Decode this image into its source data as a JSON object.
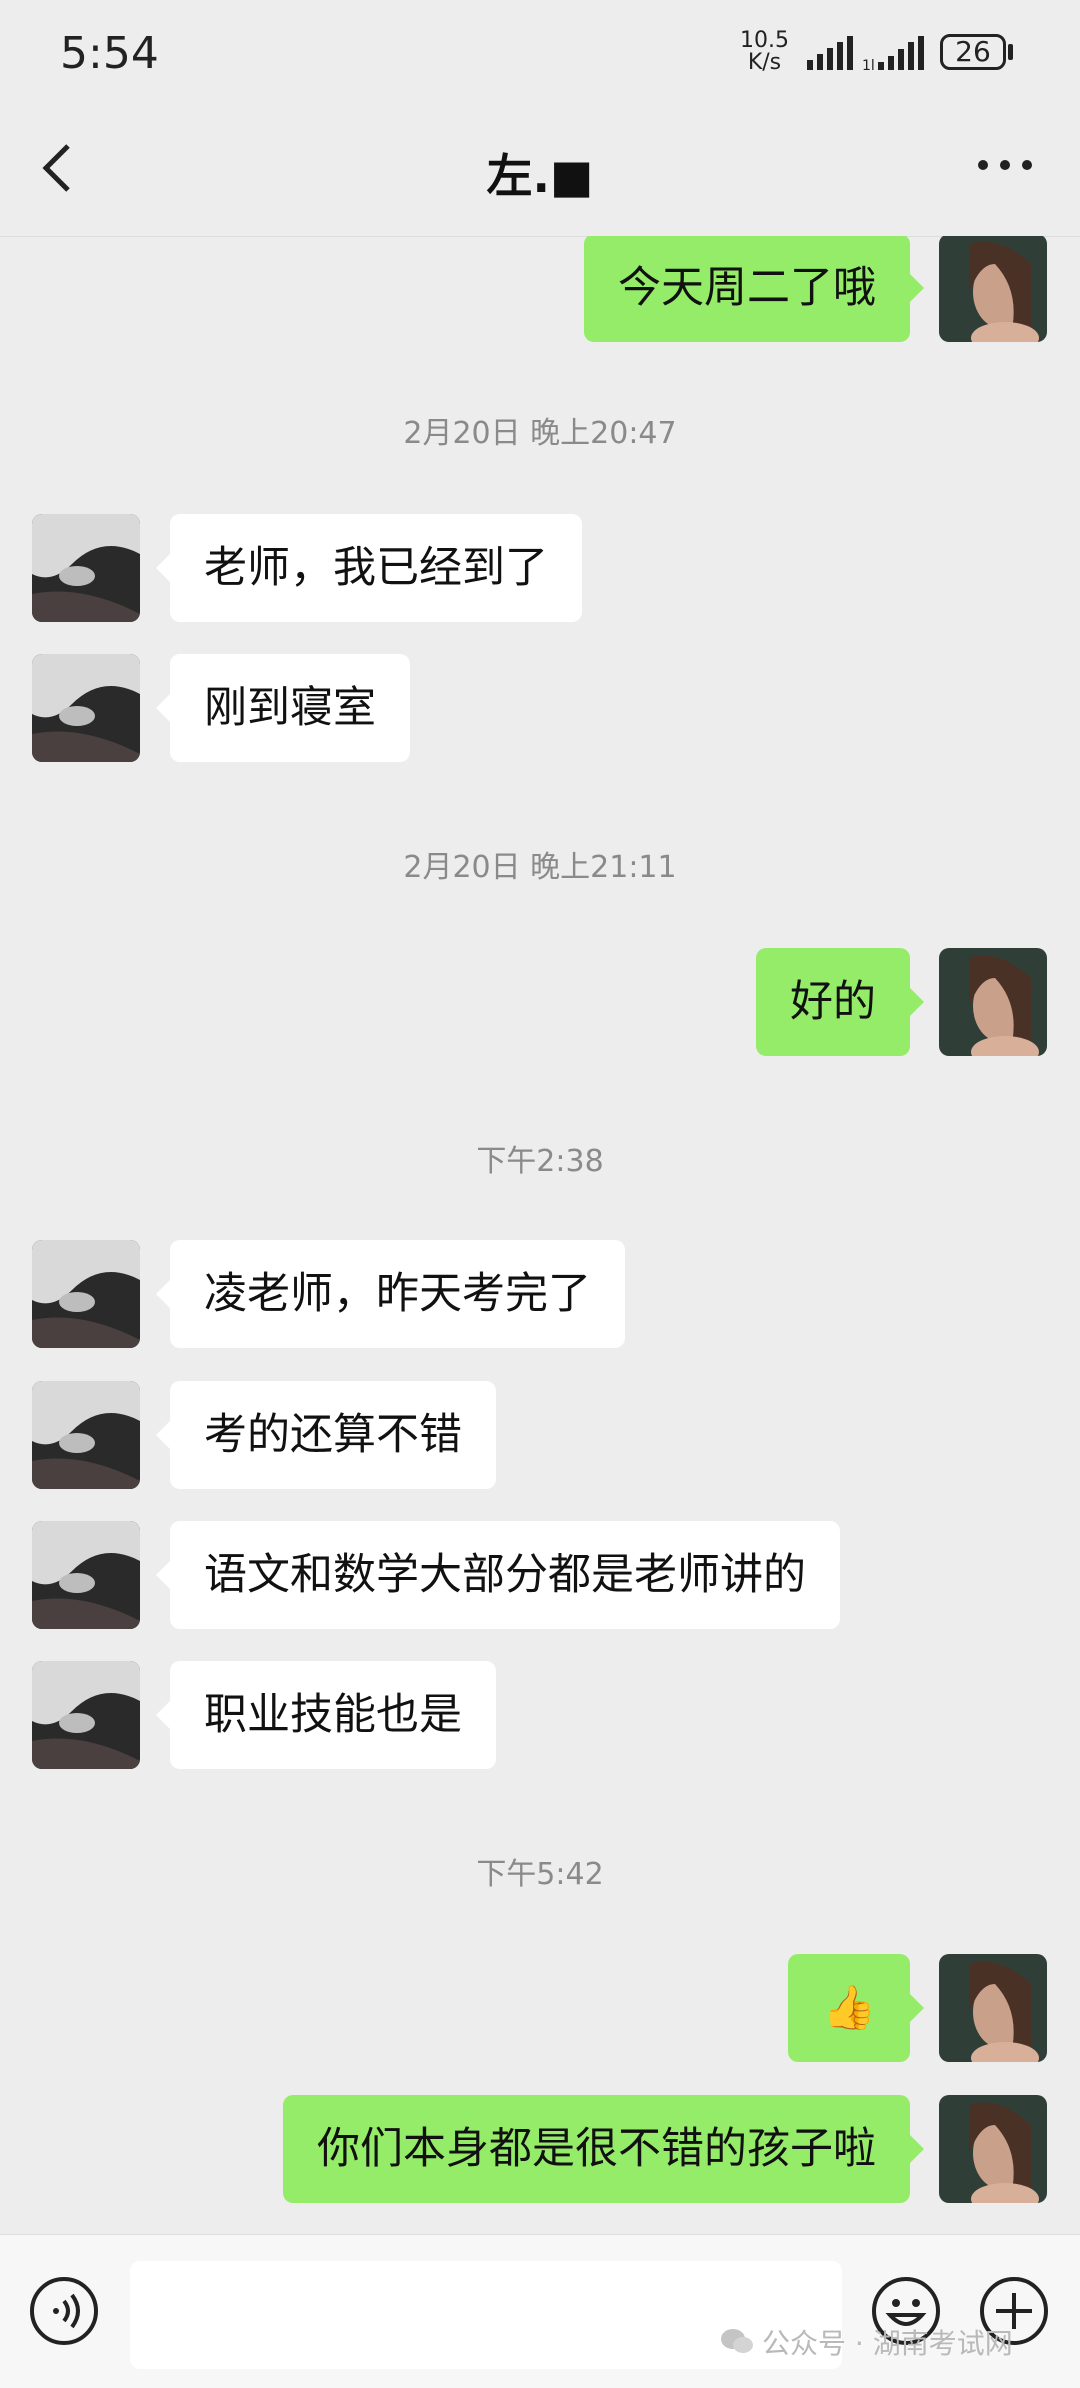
{
  "status_bar": {
    "time": "5:54",
    "net_speed_value": "10.5",
    "net_speed_unit": "K/s",
    "battery": "26"
  },
  "header": {
    "title": "左.■"
  },
  "messages": [
    {
      "kind": "out",
      "text": "今天周二了哦"
    },
    {
      "kind": "timestamp",
      "text": "2月20日 晚上20:47"
    },
    {
      "kind": "in",
      "text": "老师，我已经到了"
    },
    {
      "kind": "in",
      "text": "刚到寝室"
    },
    {
      "kind": "timestamp",
      "text": "2月20日 晚上21:11"
    },
    {
      "kind": "out",
      "text": "好的"
    },
    {
      "kind": "timestamp",
      "text": "下午2:38"
    },
    {
      "kind": "in",
      "text": "凌老师，昨天考完了"
    },
    {
      "kind": "in",
      "text": "考的还算不错"
    },
    {
      "kind": "in",
      "text": "语文和数学大部分都是老师讲的"
    },
    {
      "kind": "in",
      "text": "职业技能也是"
    },
    {
      "kind": "timestamp",
      "text": "下午5:42"
    },
    {
      "kind": "out",
      "text": "👍"
    },
    {
      "kind": "out",
      "text": "你们本身都是很不错的孩子啦"
    }
  ],
  "watermark": "公众号 · 湖南考试网",
  "colors": {
    "outgoing_bubble": "#95ec69",
    "incoming_bubble": "#ffffff",
    "background": "#ededed"
  },
  "icons": {
    "back": "chevron-left-icon",
    "more": "more-dots-icon",
    "voice": "voice-icon",
    "emoji": "emoji-icon",
    "plus": "plus-icon"
  }
}
